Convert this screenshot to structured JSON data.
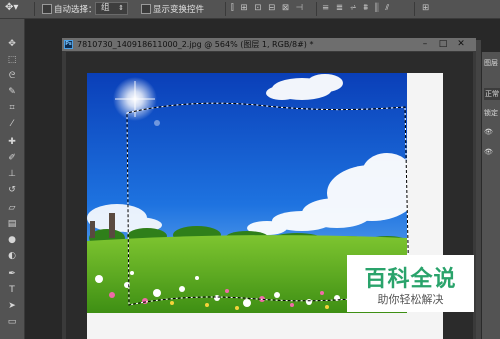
{
  "options_bar": {
    "auto_select_label": "自动选择：",
    "auto_select_value": "组",
    "show_transform_label": "显示变换控件"
  },
  "document": {
    "title": "7810730_140918611000_2.jpg @ 564% (图层 1, RGB/8#) *",
    "ps_badge": "Ps",
    "minimize": "–",
    "restore": "□",
    "close": "✕"
  },
  "right_panel": {
    "items": [
      "图层",
      "正常",
      "锁定"
    ]
  },
  "watermark": {
    "title": "百科全说",
    "subtitle": "助你轻松解决"
  },
  "icons": {
    "move_tool": "move-icon",
    "marquee_tool": "marquee-icon",
    "lasso_tool": "lasso-icon"
  }
}
